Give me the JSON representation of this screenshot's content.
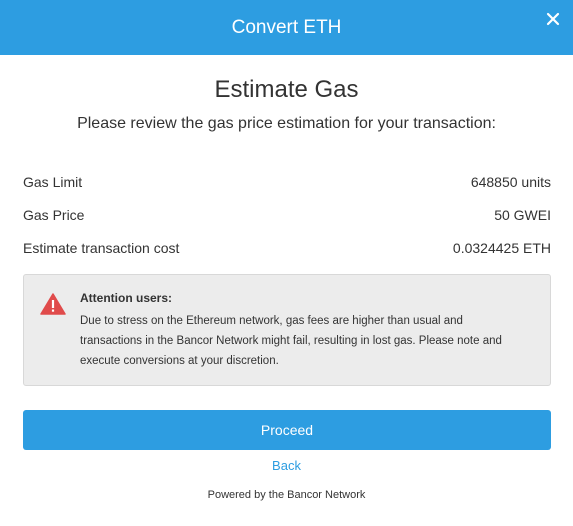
{
  "header": {
    "title": "Convert ETH",
    "close_icon": "close-icon",
    "color": "#2d9de1"
  },
  "main": {
    "title": "Estimate Gas",
    "subtitle": "Please review the gas price estimation for your transaction:"
  },
  "estimates": [
    {
      "label": "Gas Limit",
      "value": "648850 units"
    },
    {
      "label": "Gas Price",
      "value": "50 GWEI"
    },
    {
      "label": "Estimate transaction cost",
      "value": "0.0324425 ETH"
    }
  ],
  "alert": {
    "icon": "warning-icon",
    "icon_color": "#e04b4b",
    "heading": "Attention users:",
    "line1": "Due to stress on the Ethereum network, gas fees are higher than usual and",
    "line2": "transactions in the Bancor Network might fail, resulting in lost gas. Please note and",
    "line3": "execute conversions at your discretion."
  },
  "actions": {
    "proceed_label": "Proceed",
    "back_label": "Back"
  },
  "footer": {
    "text": "Powered by the Bancor Network"
  }
}
